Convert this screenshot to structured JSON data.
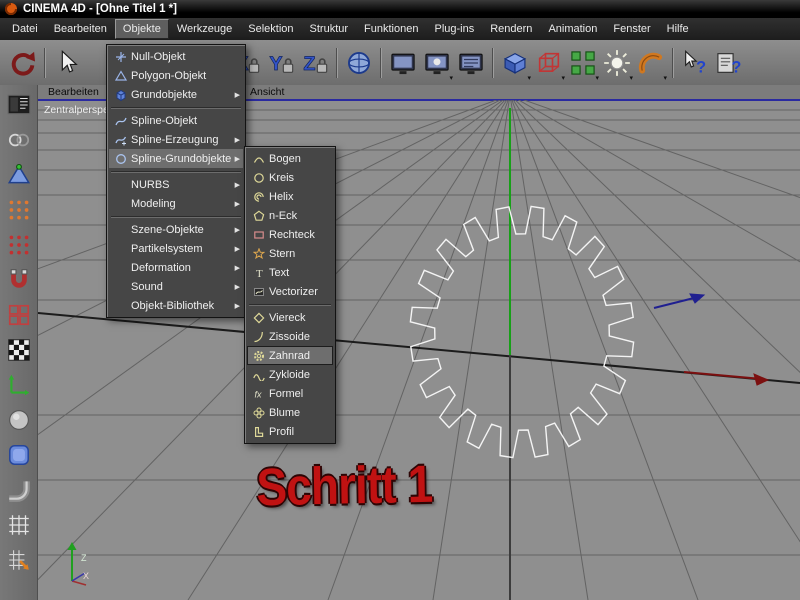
{
  "window": {
    "title": "CINEMA 4D - [Ohne Titel 1 *]"
  },
  "menubar": [
    "Datei",
    "Bearbeiten",
    "Objekte",
    "Werkzeuge",
    "Selektion",
    "Struktur",
    "Funktionen",
    "Plug-ins",
    "Rendern",
    "Animation",
    "Fenster",
    "Hilfe"
  ],
  "icons": {
    "submenu_arrow": "▶",
    "dropdown_arrow": "▾"
  },
  "toolbar": {
    "icons": [
      "undo",
      "pointer",
      "lock-x",
      "lock-y",
      "lock-z",
      "world-coordinate-system",
      "render-view",
      "render-picture-viewer",
      "render-settings",
      "add-primitive-cube",
      "add-wire-cube",
      "add-array",
      "add-light",
      "add-bend-deformer",
      "context-help",
      "help-browser"
    ]
  },
  "sidebar": {
    "icons": [
      "panel-layout",
      "rings",
      "selection-triangle",
      "orange-point-grid",
      "red-point-grid",
      "magnet",
      "red-squares",
      "checkerboard",
      "axes",
      "sphere",
      "rounded-cube",
      "pipe",
      "grid",
      "grid-arrow"
    ]
  },
  "objekte_menu": {
    "title": "Objekte",
    "items": [
      {
        "label": "Null-Objekt"
      },
      {
        "label": "Polygon-Objekt"
      },
      {
        "label": "Grundobjekte",
        "submenu": true
      },
      {
        "separator": true
      },
      {
        "label": "Spline-Objekt"
      },
      {
        "label": "Spline-Erzeugung",
        "submenu": true
      },
      {
        "label": "Spline-Grundobjekte",
        "submenu": true,
        "highlighted": true
      },
      {
        "separator": true
      },
      {
        "label": "NURBS",
        "submenu": true
      },
      {
        "label": "Modeling",
        "submenu": true
      },
      {
        "separator": true
      },
      {
        "label": "Szene-Objekte",
        "submenu": true
      },
      {
        "label": "Partikelsystem",
        "submenu": true
      },
      {
        "label": "Deformation",
        "submenu": true
      },
      {
        "label": "Sound",
        "submenu": true
      },
      {
        "label": "Objekt-Bibliothek",
        "submenu": true
      }
    ]
  },
  "spline_menu": {
    "title": "Spline-Grundobjekte",
    "items": [
      {
        "label": "Bogen"
      },
      {
        "label": "Kreis"
      },
      {
        "label": "Helix"
      },
      {
        "label": "n-Eck"
      },
      {
        "label": "Rechteck"
      },
      {
        "label": "Stern"
      },
      {
        "label": "Text"
      },
      {
        "label": "Vectorizer"
      },
      {
        "separator": true
      },
      {
        "label": "Viereck"
      },
      {
        "label": "Zissoide"
      },
      {
        "label": "Zahnrad",
        "highlighted": true
      },
      {
        "label": "Zykloide"
      },
      {
        "label": "Formel"
      },
      {
        "label": "Blume"
      },
      {
        "label": "Profil"
      }
    ]
  },
  "viewport": {
    "camera_label": "Zentralperspektive",
    "menu": [
      "Bearbeiten",
      "Ansicht"
    ],
    "annotation": "Schritt 1",
    "axis_labels": {
      "upper": "Z",
      "lower": "X"
    },
    "gear": {
      "teeth": 20
    }
  },
  "colors": {
    "viewport_bg": "#8f8f8f",
    "menu_bg": "#464646",
    "menu_highlight": "#6e6e6e",
    "active_view_line": "#2a2aa0",
    "axis_y_green": "#18a018",
    "annotation_red": "#c01212",
    "gear_stroke": "#f4f4f4"
  }
}
